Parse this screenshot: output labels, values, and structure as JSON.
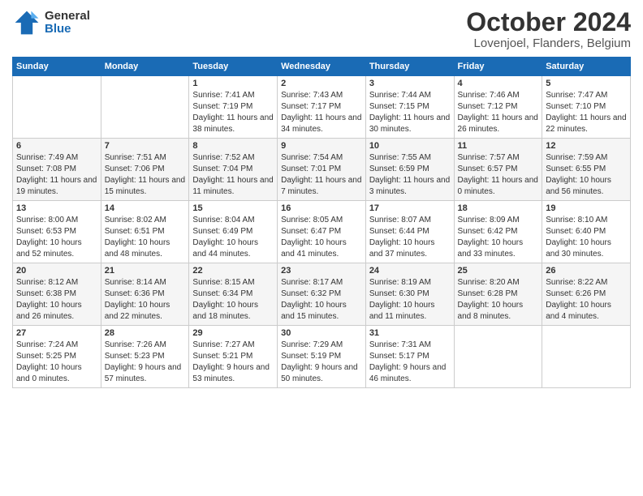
{
  "header": {
    "logo_general": "General",
    "logo_blue": "Blue",
    "month": "October 2024",
    "location": "Lovenjoel, Flanders, Belgium"
  },
  "days_of_week": [
    "Sunday",
    "Monday",
    "Tuesday",
    "Wednesday",
    "Thursday",
    "Friday",
    "Saturday"
  ],
  "weeks": [
    [
      {
        "day": "",
        "info": ""
      },
      {
        "day": "",
        "info": ""
      },
      {
        "day": "1",
        "info": "Sunrise: 7:41 AM\nSunset: 7:19 PM\nDaylight: 11 hours and 38 minutes."
      },
      {
        "day": "2",
        "info": "Sunrise: 7:43 AM\nSunset: 7:17 PM\nDaylight: 11 hours and 34 minutes."
      },
      {
        "day": "3",
        "info": "Sunrise: 7:44 AM\nSunset: 7:15 PM\nDaylight: 11 hours and 30 minutes."
      },
      {
        "day": "4",
        "info": "Sunrise: 7:46 AM\nSunset: 7:12 PM\nDaylight: 11 hours and 26 minutes."
      },
      {
        "day": "5",
        "info": "Sunrise: 7:47 AM\nSunset: 7:10 PM\nDaylight: 11 hours and 22 minutes."
      }
    ],
    [
      {
        "day": "6",
        "info": "Sunrise: 7:49 AM\nSunset: 7:08 PM\nDaylight: 11 hours and 19 minutes."
      },
      {
        "day": "7",
        "info": "Sunrise: 7:51 AM\nSunset: 7:06 PM\nDaylight: 11 hours and 15 minutes."
      },
      {
        "day": "8",
        "info": "Sunrise: 7:52 AM\nSunset: 7:04 PM\nDaylight: 11 hours and 11 minutes."
      },
      {
        "day": "9",
        "info": "Sunrise: 7:54 AM\nSunset: 7:01 PM\nDaylight: 11 hours and 7 minutes."
      },
      {
        "day": "10",
        "info": "Sunrise: 7:55 AM\nSunset: 6:59 PM\nDaylight: 11 hours and 3 minutes."
      },
      {
        "day": "11",
        "info": "Sunrise: 7:57 AM\nSunset: 6:57 PM\nDaylight: 11 hours and 0 minutes."
      },
      {
        "day": "12",
        "info": "Sunrise: 7:59 AM\nSunset: 6:55 PM\nDaylight: 10 hours and 56 minutes."
      }
    ],
    [
      {
        "day": "13",
        "info": "Sunrise: 8:00 AM\nSunset: 6:53 PM\nDaylight: 10 hours and 52 minutes."
      },
      {
        "day": "14",
        "info": "Sunrise: 8:02 AM\nSunset: 6:51 PM\nDaylight: 10 hours and 48 minutes."
      },
      {
        "day": "15",
        "info": "Sunrise: 8:04 AM\nSunset: 6:49 PM\nDaylight: 10 hours and 44 minutes."
      },
      {
        "day": "16",
        "info": "Sunrise: 8:05 AM\nSunset: 6:47 PM\nDaylight: 10 hours and 41 minutes."
      },
      {
        "day": "17",
        "info": "Sunrise: 8:07 AM\nSunset: 6:44 PM\nDaylight: 10 hours and 37 minutes."
      },
      {
        "day": "18",
        "info": "Sunrise: 8:09 AM\nSunset: 6:42 PM\nDaylight: 10 hours and 33 minutes."
      },
      {
        "day": "19",
        "info": "Sunrise: 8:10 AM\nSunset: 6:40 PM\nDaylight: 10 hours and 30 minutes."
      }
    ],
    [
      {
        "day": "20",
        "info": "Sunrise: 8:12 AM\nSunset: 6:38 PM\nDaylight: 10 hours and 26 minutes."
      },
      {
        "day": "21",
        "info": "Sunrise: 8:14 AM\nSunset: 6:36 PM\nDaylight: 10 hours and 22 minutes."
      },
      {
        "day": "22",
        "info": "Sunrise: 8:15 AM\nSunset: 6:34 PM\nDaylight: 10 hours and 18 minutes."
      },
      {
        "day": "23",
        "info": "Sunrise: 8:17 AM\nSunset: 6:32 PM\nDaylight: 10 hours and 15 minutes."
      },
      {
        "day": "24",
        "info": "Sunrise: 8:19 AM\nSunset: 6:30 PM\nDaylight: 10 hours and 11 minutes."
      },
      {
        "day": "25",
        "info": "Sunrise: 8:20 AM\nSunset: 6:28 PM\nDaylight: 10 hours and 8 minutes."
      },
      {
        "day": "26",
        "info": "Sunrise: 8:22 AM\nSunset: 6:26 PM\nDaylight: 10 hours and 4 minutes."
      }
    ],
    [
      {
        "day": "27",
        "info": "Sunrise: 7:24 AM\nSunset: 5:25 PM\nDaylight: 10 hours and 0 minutes."
      },
      {
        "day": "28",
        "info": "Sunrise: 7:26 AM\nSunset: 5:23 PM\nDaylight: 9 hours and 57 minutes."
      },
      {
        "day": "29",
        "info": "Sunrise: 7:27 AM\nSunset: 5:21 PM\nDaylight: 9 hours and 53 minutes."
      },
      {
        "day": "30",
        "info": "Sunrise: 7:29 AM\nSunset: 5:19 PM\nDaylight: 9 hours and 50 minutes."
      },
      {
        "day": "31",
        "info": "Sunrise: 7:31 AM\nSunset: 5:17 PM\nDaylight: 9 hours and 46 minutes."
      },
      {
        "day": "",
        "info": ""
      },
      {
        "day": "",
        "info": ""
      }
    ]
  ]
}
